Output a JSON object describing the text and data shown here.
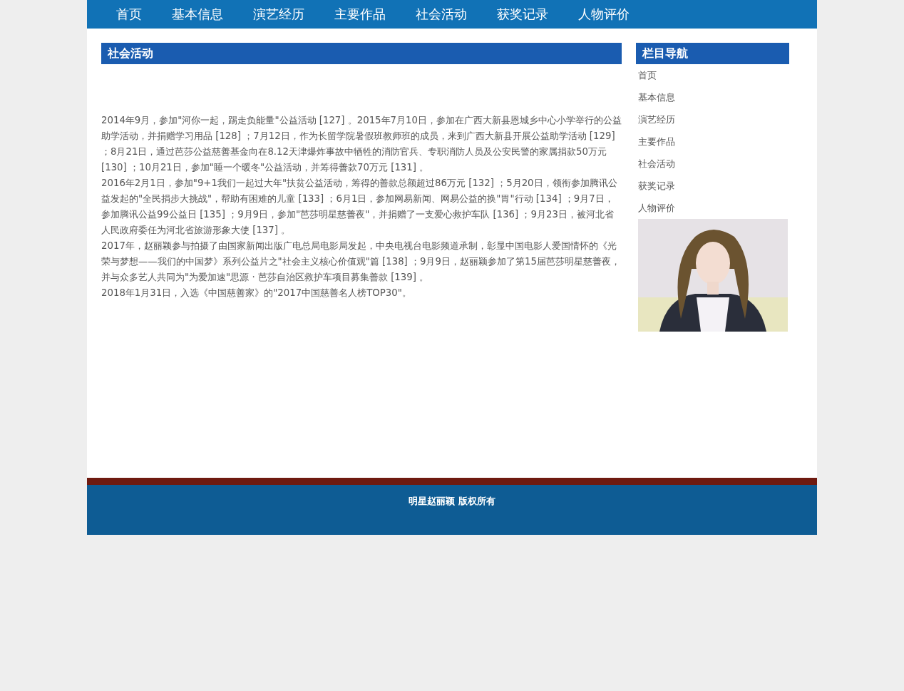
{
  "nav": [
    "首页",
    "基本信息",
    "演艺经历",
    "主要作品",
    "社会活动",
    "获奖记录",
    "人物评价"
  ],
  "main": {
    "title": "社会活动",
    "paragraphs": [
      "2014年9月，参加\"河你一起，踢走负能量\"公益活动 [127] 。2015年7月10日，参加在广西大新县恩城乡中心小学举行的公益助学活动，并捐赠学习用品 [128] ；7月12日，作为长留学院暑假班教师班的成员，来到广西大新县开展公益助学活动 [129] ；8月21日，通过芭莎公益慈善基金向在8.12天津爆炸事故中牺牲的消防官兵、专职消防人员及公安民警的家属捐款50万元 [130] ；10月21日，参加\"睡一个暖冬\"公益活动，并筹得善款70万元 [131] 。",
      "2016年2月1日，参加\"9+1我们一起过大年\"扶贫公益活动，筹得的善款总额超过86万元 [132] ；5月20日，领衔参加腾讯公益发起的\"全民捐步大挑战\"，帮助有困难的儿童 [133] ；6月1日，参加网易新闻、网易公益的换\"胃\"行动 [134] ；9月7日，参加腾讯公益99公益日 [135] ；9月9日，参加\"芭莎明星慈善夜\"，并捐赠了一支爱心救护车队 [136] ；9月23日，被河北省人民政府委任为河北省旅游形象大使 [137] 。",
      "2017年，赵丽颖参与拍摄了由国家新闻出版广电总局电影局发起，中央电视台电影频道承制，彰显中国电影人爱国情怀的《光荣与梦想——我们的中国梦》系列公益片之\"社会主义核心价值观\"篇 [138] ；9月9日，赵丽颖参加了第15届芭莎明星慈善夜，并与众多艺人共同为\"为爱加速\"思源 · 芭莎自治区救护车项目募集善款 [139] 。",
      "2018年1月31日，入选《中国慈善家》的\"2017中国慈善名人榜TOP30\"。"
    ]
  },
  "sidebar": {
    "title": "栏目导航",
    "items": [
      "首页",
      "基本信息",
      "演艺经历",
      "主要作品",
      "社会活动",
      "获奖记录",
      "人物评价"
    ]
  },
  "footer": {
    "text": "明星赵丽颖 版权所有"
  }
}
